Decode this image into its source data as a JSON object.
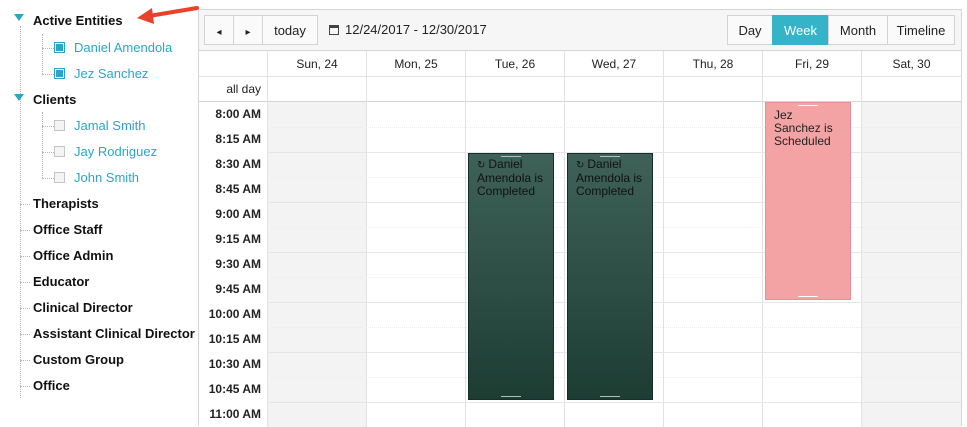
{
  "tree": {
    "active_entities": "Active Entities",
    "daniel": "Daniel Amendola",
    "jez": "Jez Sanchez",
    "clients": "Clients",
    "jamal": "Jamal Smith",
    "jay": "Jay Rodriguez",
    "john": "John Smith",
    "therapists": "Therapists",
    "office_staff": "Office Staff",
    "office_admin": "Office Admin",
    "educator": "Educator",
    "clinical_director": "Clinical Director",
    "assistant_clinical_director": "Assistant Clinical Director",
    "custom_group": "Custom Group",
    "office": "Office"
  },
  "toolbar": {
    "prev": "◂",
    "next": "▸",
    "today": "today",
    "range": "12/24/2017 - 12/30/2017",
    "day": "Day",
    "week": "Week",
    "month": "Month",
    "timeline": "Timeline"
  },
  "days": {
    "sun": "Sun, 24",
    "mon": "Mon, 25",
    "tue": "Tue, 26",
    "wed": "Wed, 27",
    "thu": "Thu, 28",
    "fri": "Fri, 29",
    "sat": "Sat, 30"
  },
  "allday_label": "all day",
  "times": {
    "t0800": "8:00 AM",
    "t0815": "8:15 AM",
    "t0830": "8:30 AM",
    "t0845": "8:45 AM",
    "t0900": "9:00 AM",
    "t0915": "9:15 AM",
    "t0930": "9:30 AM",
    "t0945": "9:45 AM",
    "t1000": "10:00 AM",
    "t1015": "10:15 AM",
    "t1030": "10:30 AM",
    "t1045": "10:45 AM",
    "t1100": "11:00 AM"
  },
  "events": {
    "tue": {
      "title": "Daniel Amendola is Completed",
      "recur_icon": "↻",
      "day": "Tue, 26",
      "start": "8:30 AM",
      "end": "10:45 AM"
    },
    "wed": {
      "title": "Daniel Amendola is Completed",
      "recur_icon": "↻",
      "day": "Wed, 27",
      "start": "8:30 AM",
      "end": "10:45 AM"
    },
    "fri": {
      "title": "Jez Sanchez is Scheduled",
      "day": "Fri, 29",
      "start": "8:00 AM",
      "end": "9:45 AM"
    }
  },
  "colors": {
    "accent": "#35b3c9",
    "completed_event": "#2f4f46",
    "scheduled_event": "#f4a3a4",
    "annotation_arrow": "#e8422b"
  }
}
